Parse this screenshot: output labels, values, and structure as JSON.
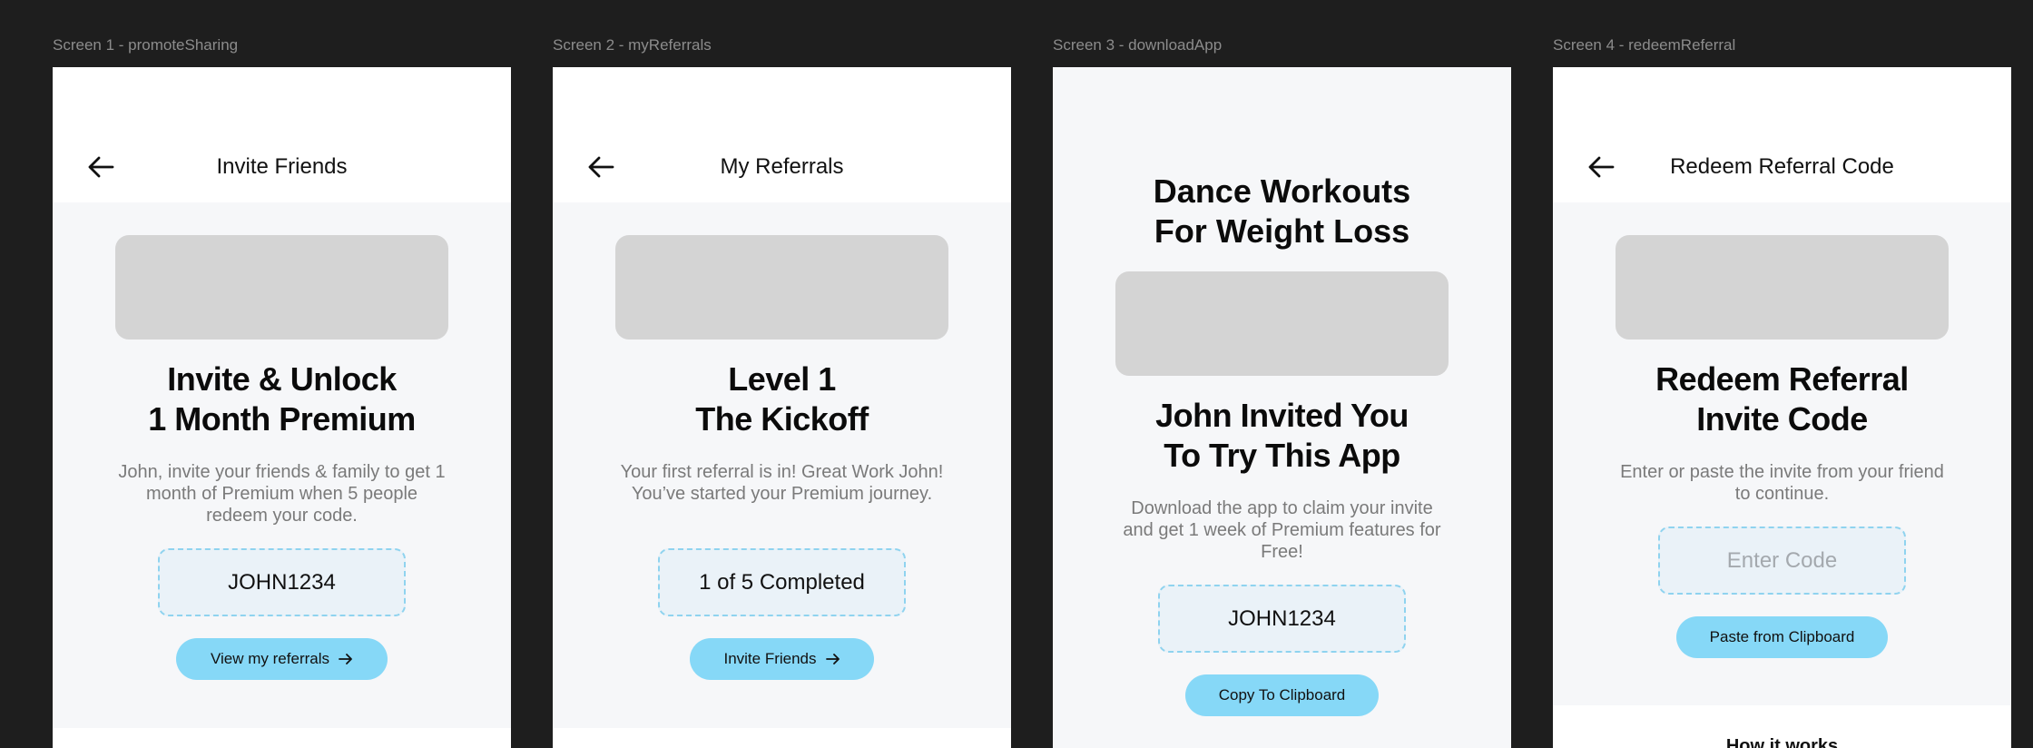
{
  "screens": [
    {
      "label": "Screen 1 - promoteSharing",
      "nav_title": "Invite Friends",
      "headline": [
        "Invite & Unlock",
        "1 Month Premium"
      ],
      "body": "John, invite your friends & family to get 1 month of Premium when 5 people redeem your code.",
      "code": "JOHN1234",
      "button": "View my referrals"
    },
    {
      "label": "Screen 2 - myReferrals",
      "nav_title": "My Referrals",
      "headline": [
        "Level 1",
        "The Kickoff"
      ],
      "body": "Your first referral is in! Great Work John! You’ve started your Premium journey.",
      "code": "1 of 5 Completed",
      "button": "Invite Friends"
    },
    {
      "label": "Screen 3 - downloadApp",
      "title": [
        "Dance Workouts",
        "For Weight Loss"
      ],
      "headline": [
        "John Invited You",
        "To Try This App"
      ],
      "body": "Download the app to claim your invite and get 1 week of Premium features for Free!",
      "code": "JOHN1234",
      "button": "Copy To Clipboard"
    },
    {
      "label": "Screen 4 - redeemReferral",
      "nav_title": "Redeem Referral Code",
      "headline": [
        "Redeem Referral",
        "Invite Code"
      ],
      "body": "Enter or paste the invite from your friend to continue.",
      "code_placeholder": "Enter Code",
      "button": "Paste from Clipboard",
      "section_title": "How it works"
    }
  ]
}
